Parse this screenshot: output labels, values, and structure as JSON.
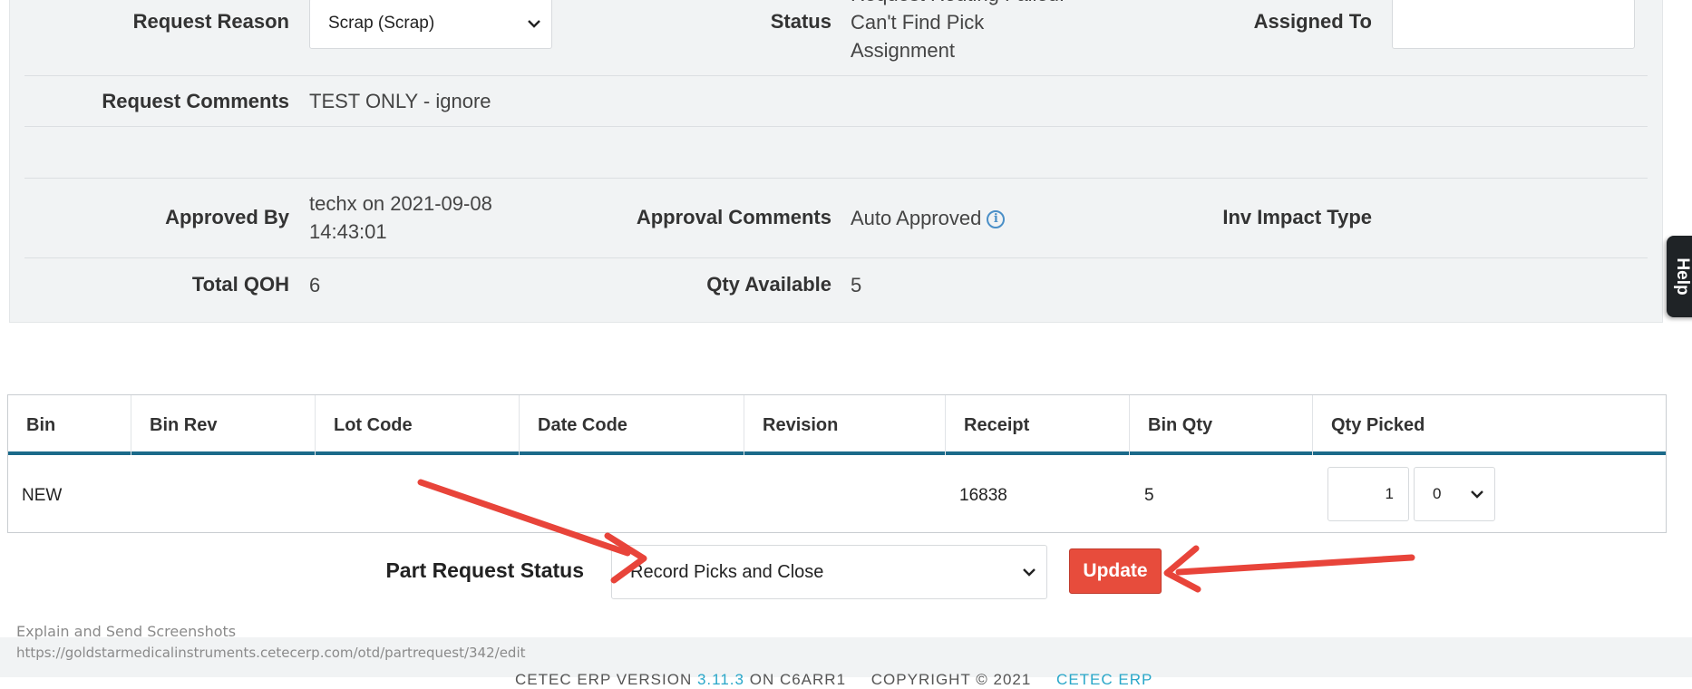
{
  "details": {
    "request_reason_label": "Request Reason",
    "request_reason_value": "Scrap (Scrap)",
    "status_label": "Status",
    "status_value_line1": "Request Routing Failed:",
    "status_value_line2": "Can't Find Pick",
    "status_value_line3": "Assignment",
    "assigned_to_label": "Assigned To",
    "assigned_to_value": "",
    "request_comments_label": "Request Comments",
    "request_comments_value": "TEST ONLY - ignore",
    "approved_by_label": "Approved By",
    "approved_by_line1": "techx on 2021-09-08",
    "approved_by_line2": "14:43:01",
    "approval_comments_label": "Approval Comments",
    "approval_comments_value": "Auto Approved",
    "inv_impact_label": "Inv Impact Type",
    "inv_impact_value": "",
    "total_qoh_label": "Total QOH",
    "total_qoh_value": "6",
    "qty_available_label": "Qty Available",
    "qty_available_value": "5"
  },
  "help_tab": {
    "label": "Help"
  },
  "bins_table": {
    "columns": [
      "Bin",
      "Bin Rev",
      "Lot Code",
      "Date Code",
      "Revision",
      "Receipt",
      "Bin Qty",
      "Qty Picked"
    ],
    "rows": [
      {
        "bin": "NEW",
        "bin_rev": "",
        "lot_code": "",
        "date_code": "",
        "revision": "",
        "receipt": "16838",
        "bin_qty": "5",
        "qty_picked": "1",
        "qty_picked_sub": "0"
      }
    ]
  },
  "part_request_status": {
    "label": "Part Request Status",
    "value": "Record Picks and Close",
    "update_label": "Update"
  },
  "footer": {
    "prefix": "CETEC ERP VERSION",
    "version": "3.11.3",
    "server": "ON C6ARR1",
    "copyright": "COPYRIGHT © 2021",
    "brand": "CETEC ERP"
  },
  "capture": {
    "title": "Explain and Send Screenshots",
    "url": "https://goldstarmedicalinstruments.cetecerp.com/otd/partrequest/342/edit"
  },
  "icons": {
    "info": "info-circle-icon",
    "dropdown": "chevron-down-icon",
    "annotation": "red-arrow-icon"
  },
  "colors": {
    "accent_blue": "#1b6a8a",
    "update_red": "#e74c3c",
    "annotation_red": "#e8443a",
    "link_cyan": "#2aa7c9"
  }
}
